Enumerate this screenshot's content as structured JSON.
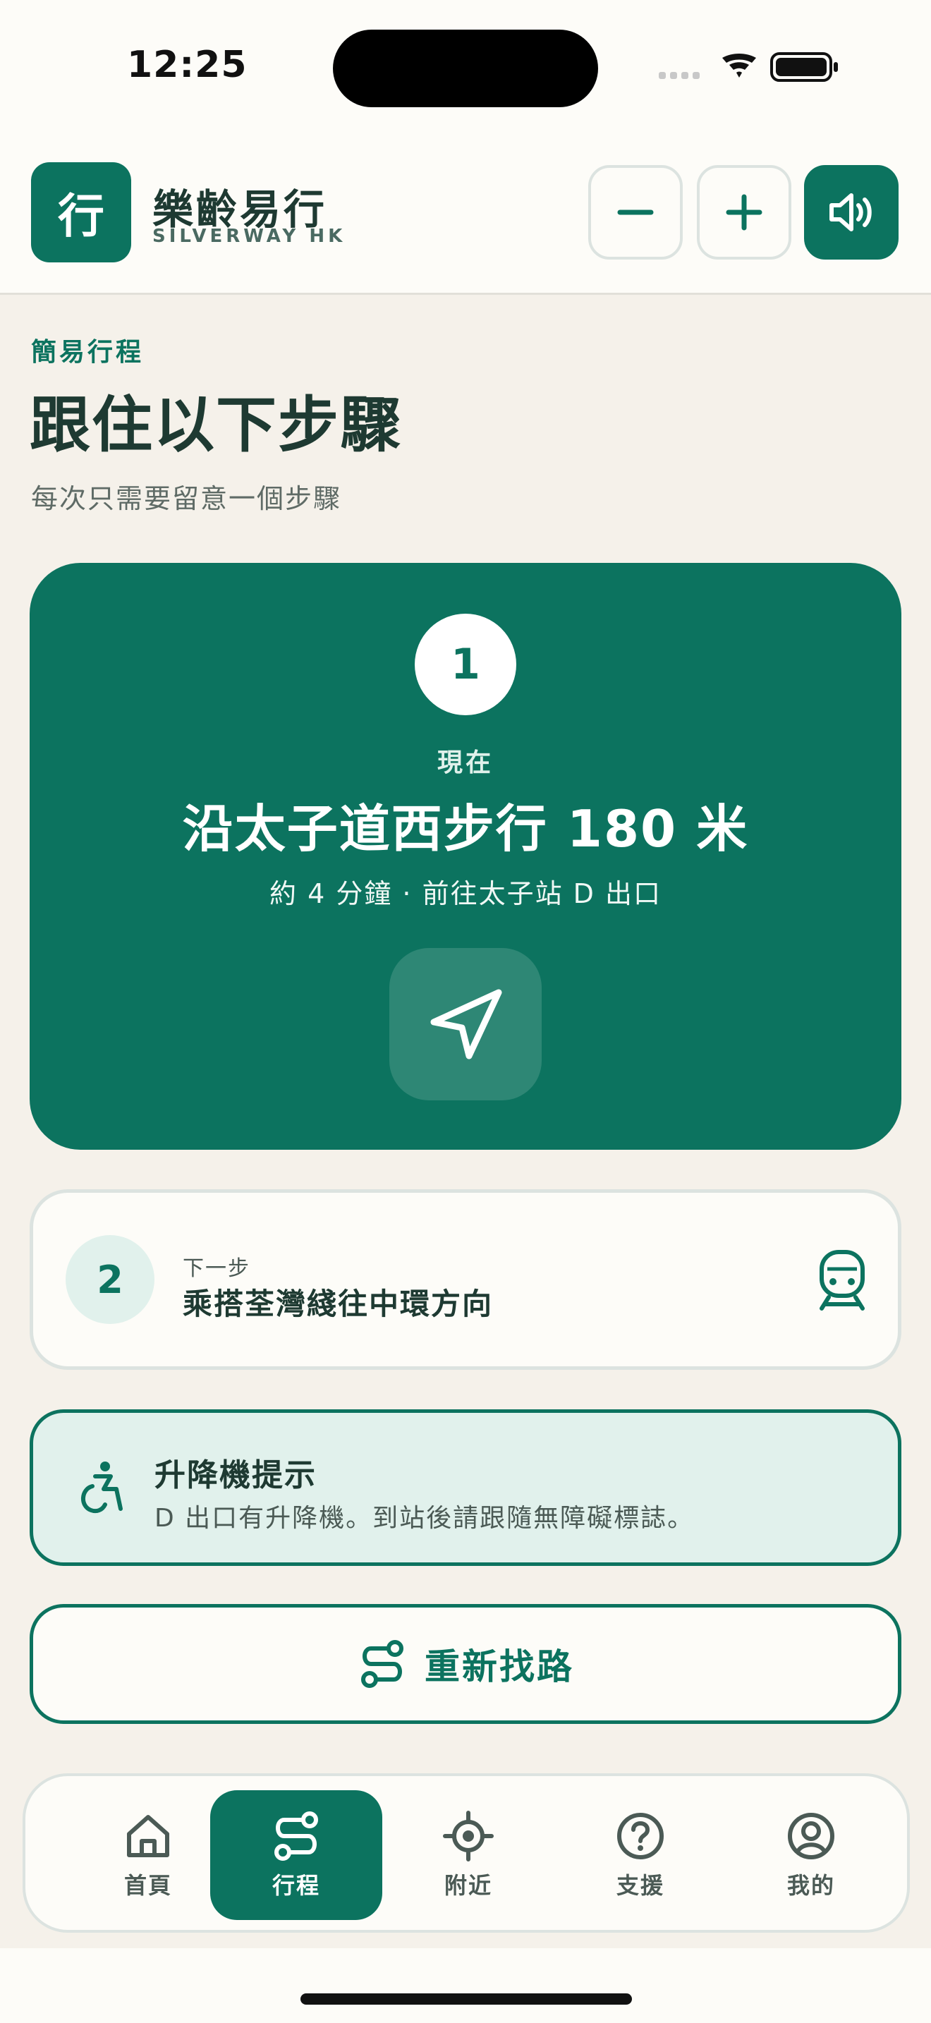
{
  "status_bar": {
    "time": "12:25"
  },
  "app": {
    "logo_char": "行",
    "name": "樂齡易行",
    "subtitle": "SILVERWAY HK"
  },
  "header_buttons": [
    "minus-icon",
    "plus-icon",
    "speaker-icon"
  ],
  "page": {
    "eyebrow": "簡易行程",
    "title": "跟住以下步驟",
    "subtitle": "每次只需要留意一個步驟"
  },
  "current_step": {
    "number": "1",
    "label": "現在",
    "instruction": "沿太子道西步行 180 米",
    "detail": "約 4 分鐘 · 前往太子站 D 出口",
    "icon": "navigation-arrow-icon"
  },
  "next_step": {
    "number": "2",
    "label": "下一步",
    "instruction": "乘搭荃灣綫往中環方向",
    "icon": "train-icon"
  },
  "tip": {
    "icon": "wheelchair-accessible-icon",
    "title": "升降機提示",
    "body": "D 出口有升降機。到站後請跟隨無障礙標誌。"
  },
  "reroute": {
    "label": "重新找路",
    "icon": "route-icon"
  },
  "tabs": [
    {
      "label": "首頁",
      "icon": "home-icon",
      "active": false
    },
    {
      "label": "行程",
      "icon": "route-icon",
      "active": true
    },
    {
      "label": "附近",
      "icon": "location-target-icon",
      "active": false
    },
    {
      "label": "支援",
      "icon": "help-icon",
      "active": false
    },
    {
      "label": "我的",
      "icon": "profile-icon",
      "active": false
    }
  ],
  "colors": {
    "primary": "#0C735F",
    "background": "#F5F1EA",
    "surface": "#FDFCF8",
    "tint": "#E1F1EC",
    "text": "#1E3A32"
  }
}
